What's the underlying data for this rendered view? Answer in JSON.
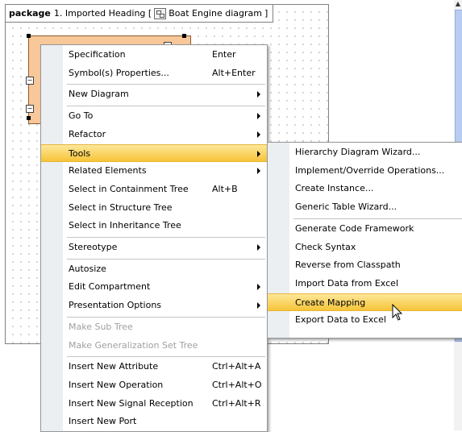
{
  "diagram": {
    "tab_keyword": "package",
    "tab_text": "1. Imported Heading [",
    "tab_diagram_name": "Boat Engine diagram",
    "tab_close": "]"
  },
  "main_menu": [
    {
      "label": "Specification",
      "shortcut": "Enter"
    },
    {
      "label": "Symbol(s) Properties...",
      "shortcut": "Alt+Enter"
    },
    {
      "separator": true
    },
    {
      "label": "New Diagram",
      "submenu": true
    },
    {
      "separator": true
    },
    {
      "label": "Go To",
      "submenu": true
    },
    {
      "label": "Refactor",
      "submenu": true
    },
    {
      "label": "Tools",
      "submenu": true,
      "highlighted": true
    },
    {
      "label": "Related Elements",
      "submenu": true
    },
    {
      "label": "Select in Containment Tree",
      "shortcut": "Alt+B"
    },
    {
      "label": "Select in Structure Tree"
    },
    {
      "label": "Select in Inheritance Tree"
    },
    {
      "separator": true
    },
    {
      "label": "Stereotype",
      "submenu": true
    },
    {
      "separator": true
    },
    {
      "label": "Autosize"
    },
    {
      "label": "Edit Compartment",
      "submenu": true
    },
    {
      "label": "Presentation Options",
      "submenu": true
    },
    {
      "separator": true
    },
    {
      "label": "Make Sub Tree",
      "disabled": true
    },
    {
      "label": "Make Generalization Set Tree",
      "disabled": true
    },
    {
      "separator": true
    },
    {
      "label": "Insert New Attribute",
      "shortcut": "Ctrl+Alt+A"
    },
    {
      "label": "Insert New Operation",
      "shortcut": "Ctrl+Alt+O"
    },
    {
      "label": "Insert New Signal Reception",
      "shortcut": "Ctrl+Alt+R"
    },
    {
      "label": "Insert New Port"
    }
  ],
  "tools_submenu": [
    {
      "label": "Hierarchy Diagram Wizard..."
    },
    {
      "label": "Implement/Override Operations..."
    },
    {
      "label": "Create Instance..."
    },
    {
      "label": "Generic Table Wizard..."
    },
    {
      "separator": true
    },
    {
      "label": "Generate Code Framework"
    },
    {
      "label": "Check Syntax"
    },
    {
      "label": "Reverse from Classpath"
    },
    {
      "label": "Import Data from Excel"
    },
    {
      "label": "Create Mapping",
      "highlighted": true
    },
    {
      "label": "Export Data to Excel"
    }
  ],
  "colors": {
    "highlight_top": "#fde79a",
    "highlight_bottom": "#f7c438",
    "menu_gutter": "#ebeff2",
    "class_fill": "#f8c89a",
    "scroll_thumb": "#b9cdf0"
  }
}
